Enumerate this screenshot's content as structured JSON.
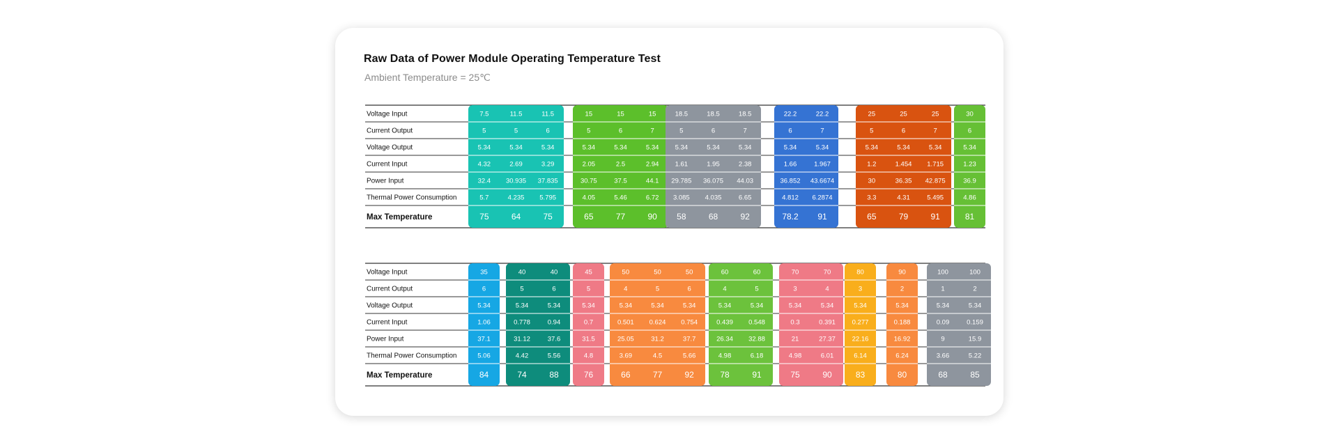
{
  "title": "Raw Data of Power Module Operating Temperature Test",
  "subtitle": "Ambient Temperature = 25℃",
  "chart_data": {
    "type": "table",
    "row_labels": [
      "Voltage Input",
      "Current Output",
      "Voltage Output",
      "Current Input",
      "Power Input",
      "Thermal Power Consumption",
      "Max Temperature"
    ],
    "tables": [
      {
        "groups": [
          {
            "color": "#19c3b3",
            "columns": [
              [
                "7.5",
                "5",
                "5.34",
                "4.32",
                "32.4",
                "5.7",
                "75"
              ],
              [
                "11.5",
                "5",
                "5.34",
                "2.69",
                "30.935",
                "4.235",
                "64"
              ],
              [
                "11.5",
                "6",
                "5.34",
                "3.29",
                "37.835",
                "5.795",
                "75"
              ]
            ]
          },
          {
            "color": "#5cbf2b",
            "columns": [
              [
                "15",
                "5",
                "5.34",
                "2.05",
                "30.75",
                "4.05",
                "65"
              ],
              [
                "15",
                "6",
                "5.34",
                "2.5",
                "37.5",
                "5.46",
                "77"
              ],
              [
                "15",
                "7",
                "5.34",
                "2.94",
                "44.1",
                "6.72",
                "90"
              ]
            ]
          },
          {
            "color": "#8e959e",
            "columns": [
              [
                "18.5",
                "5",
                "5.34",
                "1.61",
                "29.785",
                "3.085",
                "58"
              ],
              [
                "18.5",
                "6",
                "5.34",
                "1.95",
                "36.075",
                "4.035",
                "68"
              ],
              [
                "18.5",
                "7",
                "5.34",
                "2.38",
                "44.03",
                "6.65",
                "92"
              ]
            ]
          },
          {
            "color": "#3573d3",
            "columns": [
              [
                "22.2",
                "6",
                "5.34",
                "1.66",
                "36.852",
                "4.812",
                "78.2"
              ],
              [
                "22.2",
                "7",
                "5.34",
                "1.967",
                "43.6674",
                "6.2874",
                "91"
              ]
            ]
          },
          {
            "color": "#d95310",
            "columns": [
              [
                "25",
                "5",
                "5.34",
                "1.2",
                "30",
                "3.3",
                "65"
              ],
              [
                "25",
                "6",
                "5.34",
                "1.454",
                "36.35",
                "4.31",
                "79"
              ],
              [
                "25",
                "7",
                "5.34",
                "1.715",
                "42.875",
                "5.495",
                "91"
              ]
            ]
          },
          {
            "color": "#66c035",
            "columns": [
              [
                "30",
                "6",
                "5.34",
                "1.23",
                "36.9",
                "4.86",
                "81"
              ]
            ]
          }
        ]
      },
      {
        "groups": [
          {
            "color": "#16a7e4",
            "columns": [
              [
                "35",
                "6",
                "5.34",
                "1.06",
                "37.1",
                "5.06",
                "84"
              ]
            ]
          },
          {
            "color": "#0e8c7c",
            "columns": [
              [
                "40",
                "5",
                "5.34",
                "0.778",
                "31.12",
                "4.42",
                "74"
              ],
              [
                "40",
                "6",
                "5.34",
                "0.94",
                "37.6",
                "5.56",
                "88"
              ]
            ]
          },
          {
            "color": "#ef7a86",
            "columns": [
              [
                "45",
                "5",
                "5.34",
                "0.7",
                "31.5",
                "4.8",
                "76"
              ]
            ]
          },
          {
            "color": "#f88a3f",
            "columns": [
              [
                "50",
                "4",
                "5.34",
                "0.501",
                "25.05",
                "3.69",
                "66"
              ],
              [
                "50",
                "5",
                "5.34",
                "0.624",
                "31.2",
                "4.5",
                "77"
              ],
              [
                "50",
                "6",
                "5.34",
                "0.754",
                "37.7",
                "5.66",
                "92"
              ]
            ]
          },
          {
            "color": "#6cc23c",
            "columns": [
              [
                "60",
                "4",
                "5.34",
                "0.439",
                "26.34",
                "4.98",
                "78"
              ],
              [
                "60",
                "5",
                "5.34",
                "0.548",
                "32.88",
                "6.18",
                "91"
              ]
            ]
          },
          {
            "color": "#ef7a86",
            "columns": [
              [
                "70",
                "3",
                "5.34",
                "0.3",
                "21",
                "4.98",
                "75"
              ],
              [
                "70",
                "4",
                "5.34",
                "0.391",
                "27.37",
                "6.01",
                "90"
              ]
            ]
          },
          {
            "color": "#f9ae1c",
            "columns": [
              [
                "80",
                "3",
                "5.34",
                "0.277",
                "22.16",
                "6.14",
                "83"
              ]
            ]
          },
          {
            "color": "#f88a3f",
            "columns": [
              [
                "90",
                "2",
                "5.34",
                "0.188",
                "16.92",
                "6.24",
                "80"
              ]
            ]
          },
          {
            "color": "#8e959e",
            "columns": [
              [
                "100",
                "1",
                "5.34",
                "0.09",
                "9",
                "3.66",
                "68"
              ],
              [
                "100",
                "2",
                "5.34",
                "0.159",
                "15.9",
                "5.22",
                "85"
              ]
            ]
          }
        ]
      }
    ]
  }
}
